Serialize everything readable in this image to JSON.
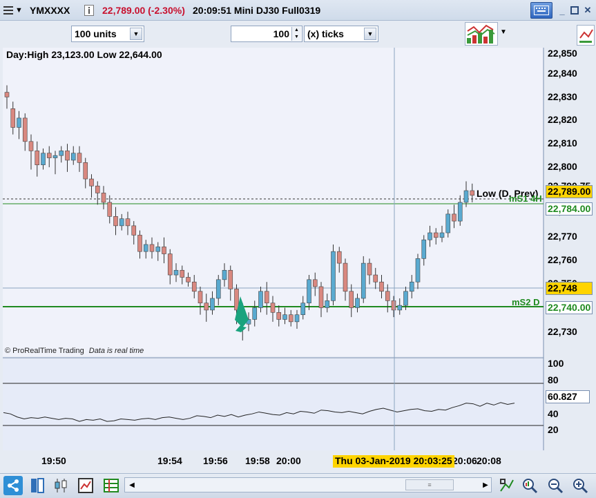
{
  "window": {
    "symbol": "YMXXXX",
    "price_change": "22,789.00 (-2.30%)",
    "time_title": "20:09:51 Mini DJ30 Full0319"
  },
  "toolbar": {
    "units": "100 units",
    "ticks_value": "100",
    "ticks_mode": "(x) ticks"
  },
  "price_panel": {
    "day_info": "Day:High 23,123.00 Low 22,644.00",
    "attribution": "© ProRealTime Trading",
    "data_status": "Data is real time",
    "y_ticks": [
      "22,850",
      "22,840",
      "22,830",
      "22,820",
      "22,810",
      "22,800",
      "22,790.75",
      "22,780",
      "22,770",
      "22,760",
      "22,750",
      "22,740",
      "22,730"
    ],
    "price_badges": [
      {
        "label": "22,789.00",
        "value": 22789,
        "color": "#ffd400"
      },
      {
        "label": "22,784.00",
        "value": 22784,
        "color": "#ffffff",
        "text_color": "#1f8a1f"
      },
      {
        "label": "22,748",
        "value": 22748,
        "color": "#ffd400"
      },
      {
        "label": "22,740.00",
        "value": 22740,
        "color": "#ffffff",
        "text_color": "#1f8a1f"
      }
    ],
    "annotations": {
      "low_prev": "Low (D, Prev)",
      "ms1": "mS1 4H",
      "ms2": "mS2 D"
    }
  },
  "oscillator_panel": {
    "y_ticks": [
      "100",
      "80",
      "40",
      "20"
    ],
    "current_value": "60.827"
  },
  "time_axis": {
    "labels": [
      "19:50",
      "19:54",
      "19:56",
      "19:58",
      "20:00",
      "20:06",
      "20:08"
    ],
    "crosshair_label": "Thu 03-Jan-2019 20:03:25"
  },
  "colors": {
    "bull": "#5aaad0",
    "bear": "#d98880",
    "support": "#1f8a1f",
    "accent": "#ffd400",
    "arrow": "#1aa37e"
  },
  "icons": [
    "keyboard-icon",
    "minimize-icon",
    "restore-icon",
    "close-icon",
    "share-icon",
    "chart-type-icon",
    "indicator-icon",
    "drawing-tools-icon",
    "trading-tools-icon",
    "scroll-left-icon",
    "scroll-right-icon",
    "measure-icon",
    "zoom-auto-icon",
    "zoom-out-icon",
    "zoom-in-icon"
  ]
}
